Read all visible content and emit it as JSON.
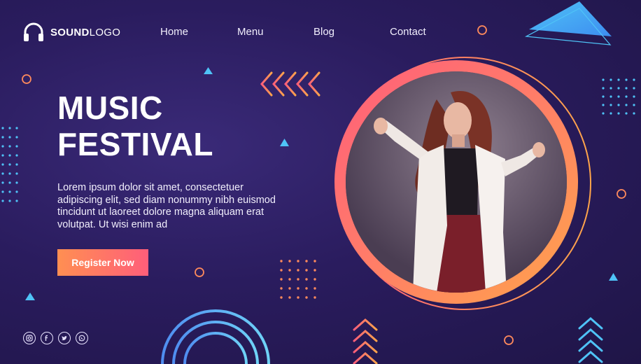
{
  "brand": {
    "logo_bold": "SOUND",
    "logo_light": "LOGO"
  },
  "nav": {
    "items": [
      "Home",
      "Menu",
      "Blog",
      "Contact"
    ]
  },
  "hero": {
    "title_line1": "MUSIC",
    "title_line2": "FESTIVAL",
    "description": "Lorem ipsum dolor sit amet, consectetuer adipiscing elit, sed diam nonummy nibh euismod tincidunt ut laoreet dolore magna aliquam erat volutpat. Ut wisi enim ad",
    "cta_label": "Register Now"
  },
  "social": [
    "instagram-icon",
    "facebook-icon",
    "twitter-icon",
    "whatsapp-icon"
  ],
  "colors": {
    "background": "#2a1c5e",
    "accent_orange": "#ffa54a",
    "accent_pink": "#ff5e7a",
    "accent_blue": "#4fc3f7",
    "accent_cyan": "#5dd6f0"
  }
}
